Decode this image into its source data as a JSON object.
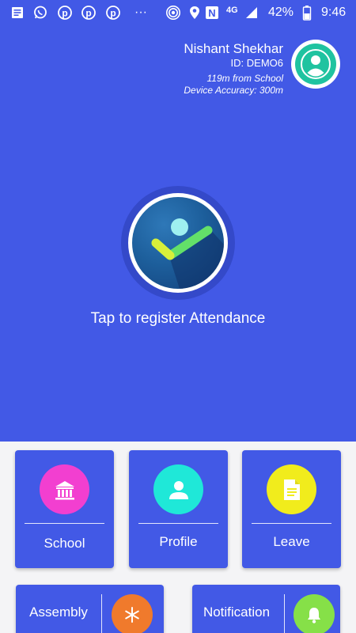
{
  "status_bar": {
    "network": "4G",
    "battery": "42%",
    "time": "9:46",
    "overflow": "···",
    "left_icons": [
      "news-icon",
      "whatsapp-icon",
      "pinterest-icon",
      "pinterest-icon",
      "pinterest-icon"
    ],
    "right_icons": [
      "hotspot-icon",
      "location-icon",
      "nfc-icon",
      "signal-icon",
      "battery-icon"
    ]
  },
  "user": {
    "name": "Nishant Shekhar",
    "id": "ID: DEMO6",
    "distance": "119m from School",
    "accuracy": "Device Accuracy: 300m"
  },
  "attendance": {
    "label": "Tap to register Attendance"
  },
  "cards": {
    "school": "School",
    "profile": "Profile",
    "leave": "Leave",
    "assembly": "Assembly",
    "notification": "Notification"
  },
  "colors": {
    "primary": "#4259e6",
    "school": "#f23fd0",
    "profile": "#1fe8d8",
    "leave": "#f1ec1c",
    "assembly": "#f07a2c",
    "notification": "#86e048",
    "avatar": "#1fc3a0"
  }
}
